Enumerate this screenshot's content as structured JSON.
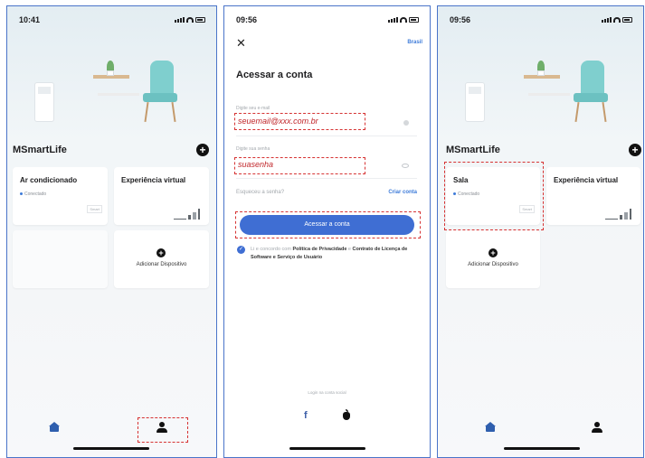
{
  "screen1": {
    "time": "10:41",
    "app_title": "MSmartLife",
    "device_card": {
      "title": "Ar condicionado",
      "status": "Conectado",
      "tag": "Smart"
    },
    "virtual_card": {
      "title": "Experiência virtual"
    },
    "add_card": {
      "label": "Adicionar Dispositivo"
    }
  },
  "screen2": {
    "time": "09:56",
    "region": "Brasil",
    "title": "Acessar a conta",
    "email": {
      "label": "Digite seu e-mail",
      "value": "seuemail@xxx.com.br"
    },
    "password": {
      "label": "Digite sua senha",
      "value": "suasenha"
    },
    "forgot": "Esqueceu a senha?",
    "create": "Criar conta",
    "login_button": "Acessar a conta",
    "terms": {
      "prefix": "Li e concordo com ",
      "privacy": "Política de Privacidade",
      "and": " e ",
      "license": "Contrato de Licença de Software e Serviço de Usuário"
    },
    "social_label": "Login na conta social",
    "facebook_glyph": "f"
  },
  "screen3": {
    "time": "09:56",
    "app_title": "MSmartLife",
    "device_card": {
      "title": "Sala",
      "status": "Conectado",
      "tag": "Smart"
    },
    "virtual_card": {
      "title": "Experiência virtual"
    },
    "add_card": {
      "label": "Adicionar Dispositivo"
    }
  },
  "icons": {
    "plus": "+",
    "close": "✕",
    "check": "✓"
  },
  "colors": {
    "accent": "#3f6ed3",
    "highlight": "#d63333",
    "frame": "#4a74c9"
  }
}
